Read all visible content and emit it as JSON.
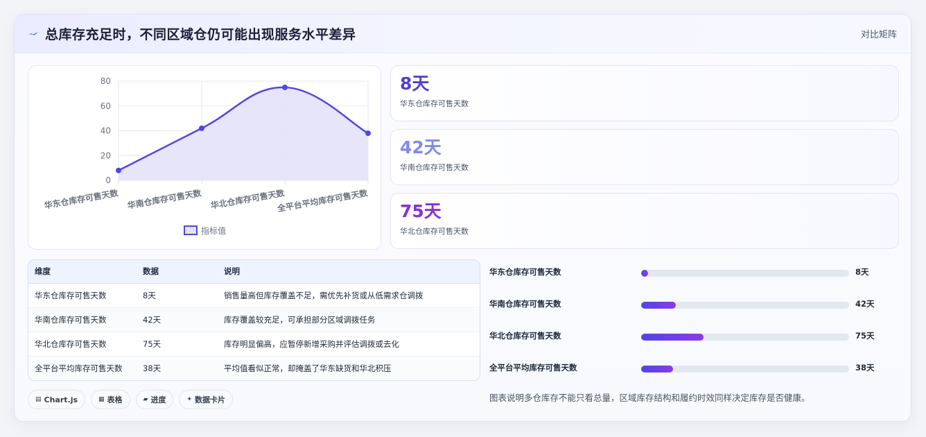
{
  "header": {
    "title": "总库存充足时，不同区域仓仍可能出现服务水平差异",
    "right_label": "对比矩阵",
    "icon": "bolt-icon"
  },
  "chart_data": {
    "type": "line",
    "categories": [
      "华东仓库存可售天数",
      "华南仓库存可售天数",
      "华北仓库存可售天数",
      "全平台平均库存可售天数"
    ],
    "series": [
      {
        "name": "指标值",
        "values": [
          8,
          42,
          75,
          38
        ]
      }
    ],
    "ylim": [
      0,
      80
    ],
    "yticks": [
      0,
      20,
      40,
      60,
      80
    ],
    "fill": true,
    "grid": true,
    "legend_position": "bottom",
    "color": "#4f46e5",
    "fill_color": "#e4e2f8"
  },
  "stats": [
    {
      "value": "8天",
      "label": "华东仓库存可售天数",
      "color": "#4f3fd6"
    },
    {
      "value": "42天",
      "label": "华南仓库存可售天数",
      "color": "#7f8bea"
    },
    {
      "value": "75天",
      "label": "华北仓库存可售天数",
      "color": "#8a2fd8"
    }
  ],
  "table": {
    "headers": [
      "维度",
      "数据",
      "说明"
    ],
    "rows": [
      [
        "华东仓库存可售天数",
        "8天",
        "销售量高但库存覆盖不足，需优先补货或从低需求仓调拨"
      ],
      [
        "华南仓库存可售天数",
        "42天",
        "库存覆盖较充足，可承担部分区域调拨任务"
      ],
      [
        "华北仓库存可售天数",
        "75天",
        "库存明显偏高，应暂停新增采购并评估调拨或去化"
      ],
      [
        "全平台平均库存可售天数",
        "38天",
        "平均值看似正常，却掩盖了华东缺货和华北积压"
      ]
    ]
  },
  "tags": [
    {
      "icon": "▤",
      "label": "Chart.js"
    },
    {
      "icon": "▦",
      "label": "表格"
    },
    {
      "icon": "▰",
      "label": "进度"
    },
    {
      "icon": "✦",
      "label": "数据卡片"
    }
  ],
  "bars": {
    "max": 250,
    "items": [
      {
        "label": "华东仓库存可售天数",
        "value": 8,
        "value_text": "8天"
      },
      {
        "label": "华南仓库存可售天数",
        "value": 42,
        "value_text": "42天"
      },
      {
        "label": "华北仓库存可售天数",
        "value": 75,
        "value_text": "75天"
      },
      {
        "label": "全平台平均库存可售天数",
        "value": 38,
        "value_text": "38天"
      }
    ]
  },
  "footnote": "图表说明多仓库存不能只看总量，区域库存结构和履约时效同样决定库存是否健康。"
}
